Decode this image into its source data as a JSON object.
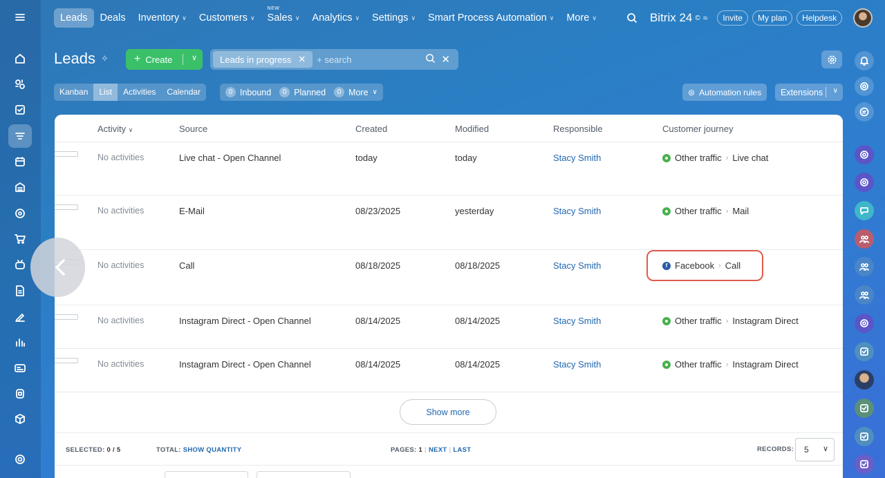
{
  "nav": {
    "items": [
      {
        "label": "Leads",
        "active": true,
        "dropdown": false
      },
      {
        "label": "Deals",
        "dropdown": false
      },
      {
        "label": "Inventory",
        "dropdown": true
      },
      {
        "label": "Customers",
        "dropdown": true
      },
      {
        "label": "Sales",
        "dropdown": true,
        "badge": "NEW"
      },
      {
        "label": "Analytics",
        "dropdown": true
      },
      {
        "label": "Settings",
        "dropdown": true
      },
      {
        "label": "Smart Process Automation",
        "dropdown": true
      },
      {
        "label": "More",
        "dropdown": true
      }
    ],
    "brand": "Bitrix 24",
    "brand_mark": "©",
    "invite": "Invite",
    "my_plan": "My plan",
    "helpdesk": "Helpdesk"
  },
  "header": {
    "title": "Leads",
    "create_label": "Create",
    "filter_tag": "Leads in progress",
    "search_placeholder": "+ search"
  },
  "view_tabs": [
    "Kanban",
    "List",
    "Activities",
    "Calendar"
  ],
  "active_view": "List",
  "counters": [
    {
      "count": "0",
      "label": "Inbound"
    },
    {
      "count": "0",
      "label": "Planned"
    },
    {
      "count": "0",
      "label": "More"
    }
  ],
  "automation_rules": "Automation rules",
  "extensions": "Extensions",
  "table": {
    "columns": [
      "Activity",
      "Source",
      "Created",
      "Modified",
      "Responsible",
      "Customer journey"
    ],
    "rows": [
      {
        "activity": "No activities",
        "source": "Live chat - Open Channel",
        "created": "today",
        "modified": "today",
        "responsible": "Stacy Smith",
        "journey_from": "Other traffic",
        "journey_to": "Live chat",
        "journey_type": "other"
      },
      {
        "activity": "No activities",
        "source": "E-Mail",
        "created": "08/23/2025",
        "modified": "yesterday",
        "responsible": "Stacy Smith",
        "journey_from": "Other traffic",
        "journey_to": "Mail",
        "journey_type": "other"
      },
      {
        "activity": "No activities",
        "source": "Call",
        "created": "08/18/2025",
        "modified": "08/18/2025",
        "responsible": "Stacy Smith",
        "journey_from": "Facebook",
        "journey_to": "Call",
        "journey_type": "facebook"
      },
      {
        "activity": "No activities",
        "source": "Instagram Direct - Open Channel",
        "created": "08/14/2025",
        "modified": "08/14/2025",
        "responsible": "Stacy Smith",
        "journey_from": "Other traffic",
        "journey_to": "Instagram Direct",
        "journey_type": "other"
      },
      {
        "activity": "No activities",
        "source": "Instagram Direct - Open Channel",
        "created": "08/14/2025",
        "modified": "08/14/2025",
        "responsible": "Stacy Smith",
        "journey_from": "Other traffic",
        "journey_to": "Instagram Direct",
        "journey_type": "other"
      }
    ]
  },
  "show_more": "Show more",
  "footer": {
    "selected_label": "SELECTED:",
    "selected_value": "0 / 5",
    "total_label": "TOTAL:",
    "total_link": "SHOW QUANTITY",
    "pages_label": "PAGES:",
    "pages_value": "1",
    "next": "NEXT",
    "last": "LAST",
    "records_label": "RECORDS:",
    "records_value": "5"
  },
  "colors": {
    "accent_green": "#3bc06a",
    "link_blue": "#2067b0",
    "highlight_red": "#e05a4c"
  },
  "sidebar_icons": [
    "menu-icon",
    "home-icon",
    "chat-icon",
    "tasks-icon",
    "crm-icon",
    "calendar-icon",
    "inventory-icon",
    "sites-icon",
    "shop-icon",
    "robot-icon",
    "docs-icon",
    "sign-icon",
    "analytics-icon",
    "contact-center-icon",
    "booking-icon",
    "apps-icon",
    "settings-icon"
  ]
}
